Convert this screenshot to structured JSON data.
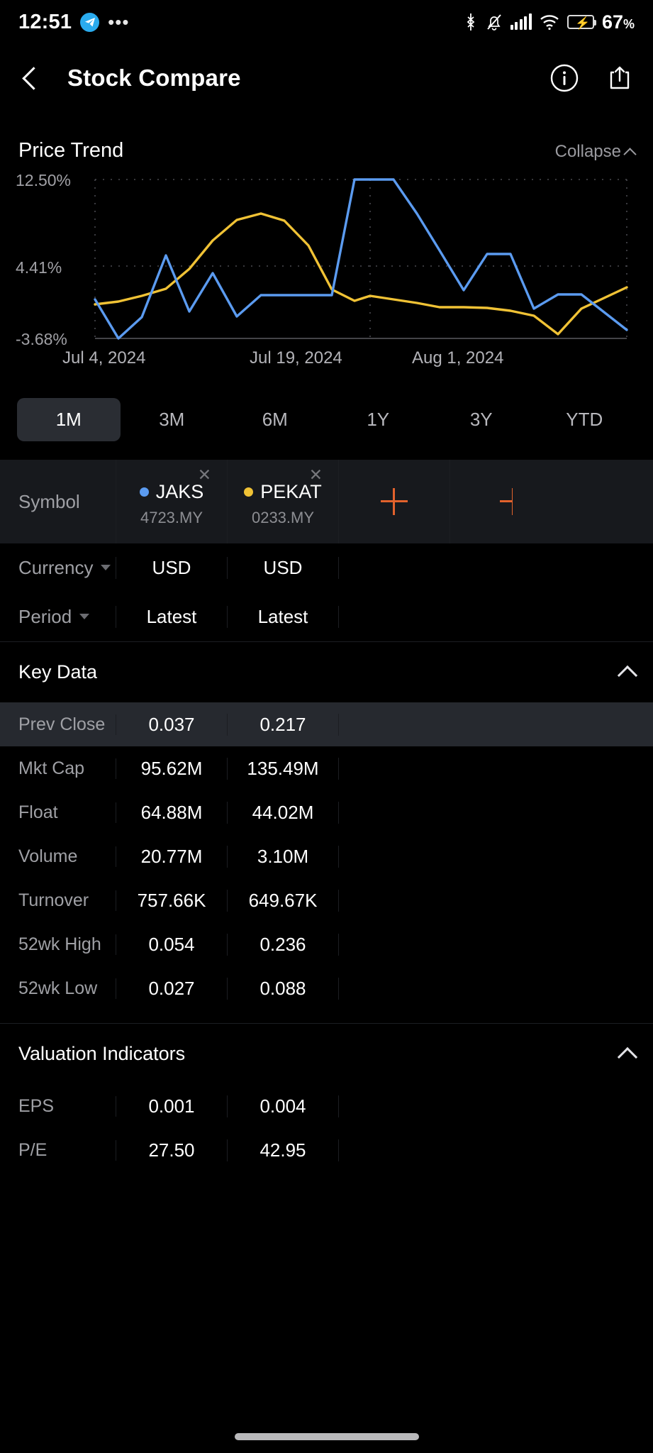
{
  "status_bar": {
    "time": "12:51",
    "telegram_icon": "telegram-icon",
    "overflow_dots": "•••",
    "bluetooth_icon": "bluetooth-icon",
    "mute_icon": "bell-muted-icon",
    "signal_icon": "cellular-signal-icon",
    "wifi_icon": "wifi-icon",
    "battery_icon": "battery-charging-icon",
    "battery_percent": "67",
    "battery_percent_unit": "%"
  },
  "app_bar": {
    "back_icon": "back-chevron-icon",
    "title": "Stock Compare",
    "info_icon": "info-circle-icon",
    "share_icon": "share-icon"
  },
  "price_trend": {
    "title": "Price Trend",
    "collapse_label": "Collapse"
  },
  "chart_data": {
    "type": "line",
    "title": "Price Trend",
    "xlabel": "",
    "ylabel": "",
    "grid": true,
    "legend_position": "external-table",
    "ylim": [
      -3.68,
      12.5
    ],
    "ytick_labels": [
      "12.50%",
      "4.41%",
      "-3.68%"
    ],
    "yticks": [
      12.5,
      4.41,
      -3.68
    ],
    "xtick_labels": [
      "Jul 4, 2024",
      "Jul 19, 2024",
      "Aug 1, 2024"
    ],
    "x": [
      "Jul 4, 2024",
      "Jul 5, 2024",
      "Jul 8, 2024",
      "Jul 9, 2024",
      "Jul 10, 2024",
      "Jul 11, 2024",
      "Jul 12, 2024",
      "Jul 15, 2024",
      "Jul 16, 2024",
      "Jul 17, 2024",
      "Jul 18, 2024",
      "Jul 19, 2024",
      "Jul 22, 2024",
      "Jul 23, 2024",
      "Jul 24, 2024",
      "Jul 25, 2024",
      "Jul 26, 2024",
      "Jul 29, 2024",
      "Jul 30, 2024",
      "Jul 31, 2024",
      "Aug 1, 2024"
    ],
    "series": [
      {
        "name": "JAKS",
        "color": "#5b9bf0",
        "values": [
          1.35,
          -3.68,
          0.0,
          5.6,
          1.4,
          4.05,
          0.4,
          2.7,
          2.7,
          2.7,
          2.7,
          12.5,
          12.5,
          8.9,
          5.7,
          2.6,
          5.85,
          5.85,
          1.4,
          2.6,
          -3.3
        ]
      },
      {
        "name": "PEKAT",
        "color": "#f0c235",
        "values": [
          0.55,
          1.0,
          1.4,
          2.6,
          4.7,
          7.45,
          9.8,
          10.6,
          9.8,
          7.4,
          2.6,
          1.1,
          0.55,
          1.7,
          1.35,
          0.6,
          0.6,
          0.6,
          0.1,
          -0.55,
          -3.0,
          0.3,
          3.3
        ]
      }
    ]
  },
  "period_tabs": {
    "active": "1M",
    "items": [
      "1M",
      "3M",
      "6M",
      "1Y",
      "3Y",
      "YTD"
    ]
  },
  "compare_table": {
    "symbol_label": "Symbol",
    "add_label": "+",
    "remove_label": "✕",
    "columns": [
      {
        "name": "JAKS",
        "code": "4723.MY",
        "color": "#5b9bf0"
      },
      {
        "name": "PEKAT",
        "code": "0233.MY",
        "color": "#f0c235"
      }
    ],
    "controls": [
      {
        "label": "Currency",
        "values": [
          "USD",
          "USD"
        ]
      },
      {
        "label": "Period",
        "values": [
          "Latest",
          "Latest"
        ]
      }
    ],
    "sections": [
      {
        "title": "Key Data",
        "rows": [
          {
            "label": "Prev Close",
            "values": [
              "0.037",
              "0.217"
            ],
            "highlight": true
          },
          {
            "label": "Mkt Cap",
            "values": [
              "95.62M",
              "135.49M"
            ],
            "highlight": false
          },
          {
            "label": "Float",
            "values": [
              "64.88M",
              "44.02M"
            ],
            "highlight": false
          },
          {
            "label": "Volume",
            "values": [
              "20.77M",
              "3.10M"
            ],
            "highlight": false
          },
          {
            "label": "Turnover",
            "values": [
              "757.66K",
              "649.67K"
            ],
            "highlight": false
          },
          {
            "label": "52wk High",
            "values": [
              "0.054",
              "0.236"
            ],
            "highlight": false
          },
          {
            "label": "52wk Low",
            "values": [
              "0.027",
              "0.088"
            ],
            "highlight": false
          }
        ]
      },
      {
        "title": "Valuation Indicators",
        "rows": [
          {
            "label": "EPS",
            "values": [
              "0.001",
              "0.004"
            ],
            "highlight": false
          },
          {
            "label": "P/E",
            "values": [
              "27.50",
              "42.95"
            ],
            "highlight": false
          }
        ]
      }
    ]
  },
  "colors": {
    "accent_orange": "#e2622c",
    "series_blue": "#5b9bf0",
    "series_yellow": "#f0c235",
    "background": "#000000",
    "row_highlight": "#26292f"
  }
}
